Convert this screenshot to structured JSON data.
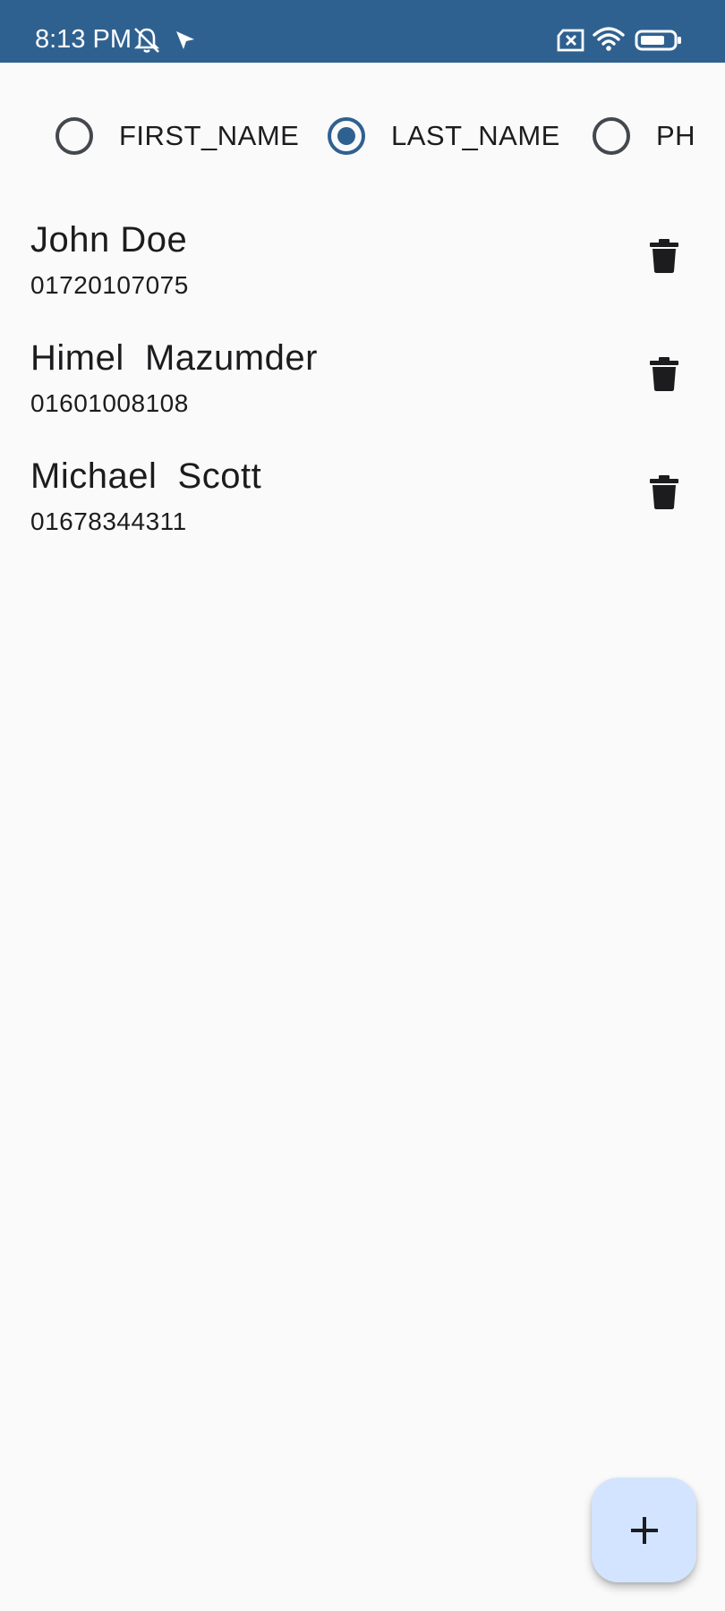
{
  "status_bar": {
    "time": "8:13 PM",
    "icons": [
      "mute-alarm-icon",
      "location-arrow-icon",
      "no-sim-icon",
      "wifi-icon",
      "battery-icon"
    ]
  },
  "sort_options": [
    {
      "label": "FIRST_NAME",
      "selected": false
    },
    {
      "label": "LAST_NAME",
      "selected": true
    },
    {
      "label": "PH",
      "selected": false
    }
  ],
  "contacts": [
    {
      "name": "John Doe",
      "phone": "01720107075"
    },
    {
      "name": "Himel  Mazumder",
      "phone": "01601008108"
    },
    {
      "name": "Michael  Scott",
      "phone": "01678344311"
    }
  ],
  "fab": {
    "icon": "add-icon"
  },
  "colors": {
    "status_bar": "#2f6190",
    "accent": "#2f6190",
    "fab": "#d2e4ff",
    "background": "#fafafa"
  }
}
